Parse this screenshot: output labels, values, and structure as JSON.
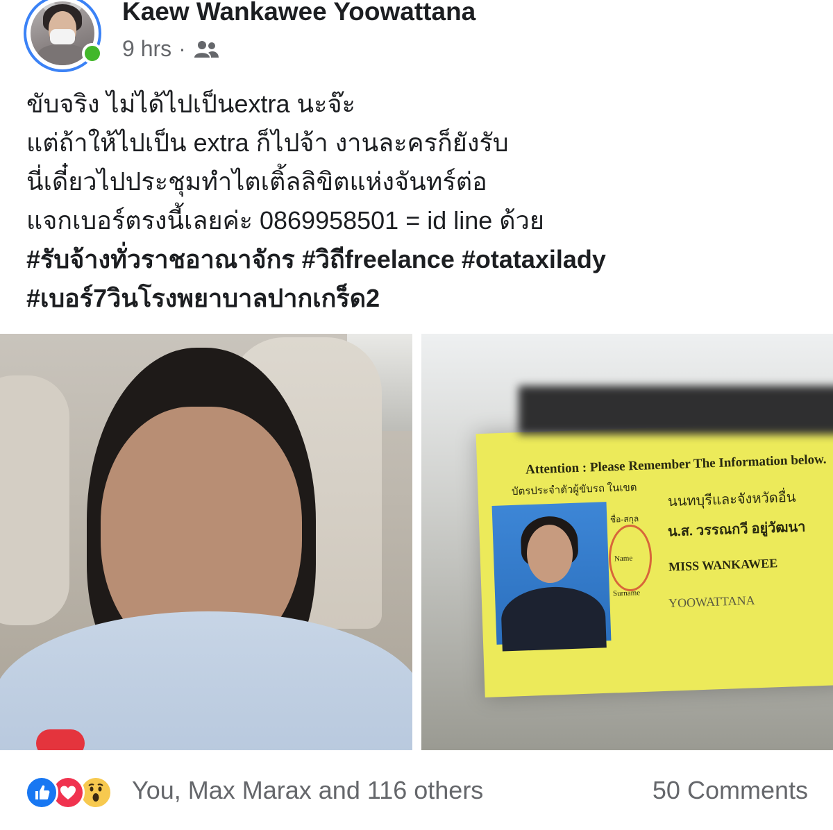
{
  "post": {
    "author": "Kaew Wankawee Yoowattana",
    "time": "9 hrs",
    "separator": "·",
    "audience_icon": "friends-icon",
    "lines": [
      "ขับจริง ไม่ได้ไปเป็นextra นะจ๊ะ",
      "แต่ถ้าให้ไปเป็น extra ก็ไปจ้า งานละครก็ยังรับ",
      "นี่เดี๋ยวไปประชุมทำไตเติ้ลลิขิตแห่งจันทร์ต่อ",
      "แจกเบอร์ตรงนี้เลยค่ะ 0869958501 = id line ด้วย"
    ],
    "hashtag_lines": [
      "#รับจ้างทั่วราชอาณาจักร #วิถีfreelance #otataxilady",
      "#เบอร์7วินโรงพยาบาลปากเกร็ด2"
    ]
  },
  "photos": {
    "right_card": {
      "attention": "Attention : Please Remember The Information below.",
      "card_type": "บัตรประจำตัวผู้ขับรถ ในเขต",
      "region": "นนทบุรีและจังหวัดอื่น",
      "name_label_th": "ชื่อ-สกุล",
      "name_th": "น.ส. วรรณกวี อยู่วัฒนา",
      "name_label_en": "Name",
      "name_en": "MISS WANKAWEE",
      "surname_label": "Surname",
      "surname": "YOOWATTANA"
    }
  },
  "footer": {
    "reactions": [
      "like-icon",
      "love-icon",
      "wow-icon"
    ],
    "reactors_text": "You, Max Marax and 116 others",
    "comments_text": "50 Comments"
  },
  "colors": {
    "like": "#1877f2",
    "love": "#f0334f",
    "wow": "#f7c94f",
    "online": "#42b72a",
    "meta_text": "#65676b"
  }
}
